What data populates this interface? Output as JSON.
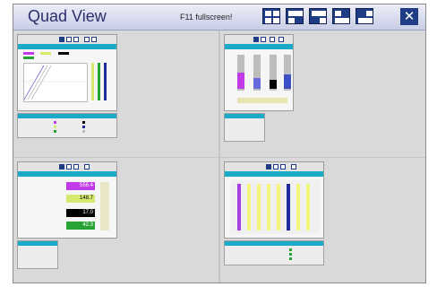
{
  "header": {
    "title": "Quad View",
    "hint": "F11 fullscreen!",
    "close_glyph": "✕"
  },
  "layout_buttons": [
    {
      "icon": "quad-layout-icon"
    },
    {
      "icon": "layout-1-icon"
    },
    {
      "icon": "layout-2-icon"
    },
    {
      "icon": "layout-3-icon"
    },
    {
      "icon": "layout-4-icon"
    }
  ],
  "panels": {
    "left_values": [
      "556.4",
      "148.7",
      "17.0",
      "42.3"
    ],
    "left_colors": [
      "#c23be8",
      "#d7e86e",
      "#000000",
      "#28a436"
    ],
    "bottom_right_bars": [
      "#a63fe2",
      "#f4f67b",
      "#f4f67b",
      "#f4f67b",
      "#f4f67b",
      "#1f2a9b",
      "#f4f67b",
      "#f4f67b"
    ]
  }
}
